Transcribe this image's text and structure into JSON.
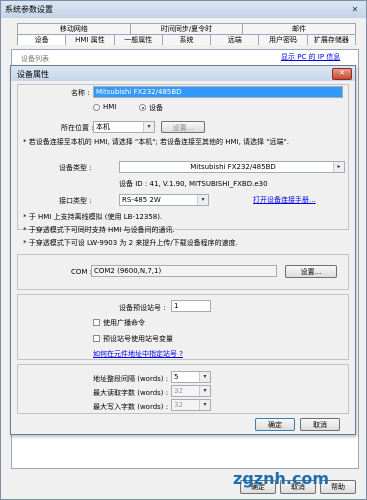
{
  "window": {
    "title": "系统参数设置"
  },
  "tabs_row1": [
    "移动网络",
    "时间同步/夏令时",
    "邮件"
  ],
  "tabs_row2": [
    "设备",
    "HMI 属性",
    "一般属性",
    "系统",
    "远端",
    "用户密码",
    "扩展存储器"
  ],
  "device_list_label": "设备列表",
  "device_list_link": "显示 PC 的 IP 信息",
  "dialog": {
    "title": "设备属性",
    "name_label": "名称 :",
    "name_value": "Mitsubishi FX232/485BD",
    "radio_hmi": "HMI",
    "radio_device": "设备",
    "location_label": "所在位置 :",
    "location_value": "本机",
    "location_settings": "设置...",
    "location_note": "* 若设备连接至本机的 HMI, 请选择 \"本机\"; 若设备连接至其他的 HMI, 请选择 \"远端\".",
    "device_type_label": "设备类型 :",
    "device_type_value": "Mitsubishi FX232/485BD",
    "device_id": "设备 ID : 41, V.1.90, MITSUBISHI_FXBD.e30",
    "interface_label": "接口类型 :",
    "interface_value": "RS-485 2W",
    "connect_manual": "打开设备连接手册...",
    "note1": "* 于 HMI 上支持离线模拟 (使用 LB-12358).",
    "note2": "* 于穿透模式下可同时支持 HMI 与设备间的通讯.",
    "note3": "* 于穿透模式下可设 LW-9903 为 2 来提升上传/下载设备程序的速度.",
    "com_label": "COM :",
    "com_value": "COM2 (9600,N,7,1)",
    "com_settings": "设置...",
    "default_station_label": "设备预设站号 :",
    "default_station_value": "1",
    "broadcast_label": "使用广播命令",
    "preset_station_var_label": "预设站号使用站号变量",
    "addr_station_link": "如何在元件地址中指定站号 ?",
    "addr_interval_label": "地址整段间隔 (words) :",
    "addr_interval_value": "5",
    "max_read_label": "最大读取字数 (words) :",
    "max_read_value": "32",
    "max_write_label": "最大写入字数 (words) :",
    "max_write_value": "32",
    "ok": "确定",
    "cancel": "取消"
  },
  "bottom_buttons": [
    "确定",
    "取消",
    "帮助"
  ],
  "watermark": "zgznh.com"
}
